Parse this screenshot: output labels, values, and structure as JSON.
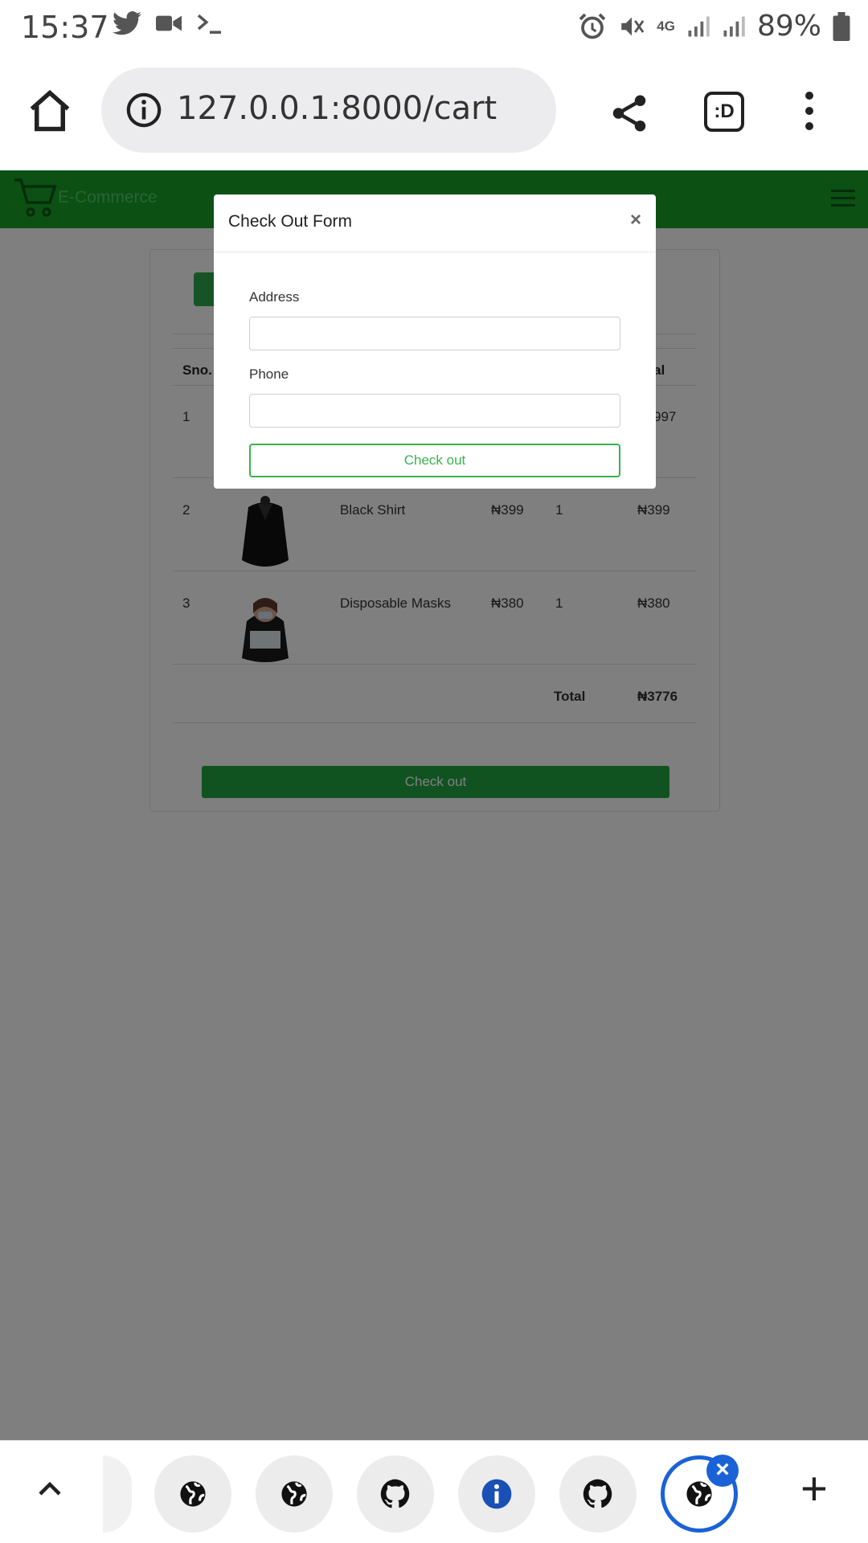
{
  "status_bar": {
    "time": "15:37",
    "left_icons": [
      "twitter-icon",
      "video-camera-icon",
      "terminal-icon"
    ],
    "right_icons": [
      "alarm-icon",
      "mute-icon",
      "4g-icon",
      "signal-icon",
      "signal-icon"
    ],
    "network": "4G",
    "battery": "89%"
  },
  "browser": {
    "url": "127.0.0.1:8000/cart",
    "extension_label": ":D"
  },
  "site": {
    "brand": "E-Commerce"
  },
  "cart": {
    "headers": {
      "sno": "Sno.",
      "total": "al"
    },
    "rows": [
      {
        "sno": "1",
        "name": "",
        "price": "",
        "qty": "",
        "total": "997"
      },
      {
        "sno": "2",
        "name": "Black Shirt",
        "price": "₦399",
        "qty": "1",
        "total": "₦399"
      },
      {
        "sno": "3",
        "name": "Disposable Masks",
        "price": "₦380",
        "qty": "1",
        "total": "₦380"
      }
    ],
    "total_label": "Total",
    "grand_total": "₦3776",
    "checkout_label": "Check out"
  },
  "modal": {
    "title": "Check Out Form",
    "close": "×",
    "address_label": "Address",
    "address_value": "",
    "phone_label": "Phone",
    "phone_value": "",
    "submit_label": "Check out"
  },
  "tabs": {
    "items": [
      "globe-icon",
      "globe-icon",
      "github-icon",
      "info-icon",
      "github-icon",
      "globe-icon"
    ],
    "active_index": 5,
    "close_badge": "×",
    "new_tab": "+"
  },
  "colors": {
    "nav_green": "#18a129",
    "button_green": "#23a443",
    "accent_blue": "#1a62d6"
  }
}
